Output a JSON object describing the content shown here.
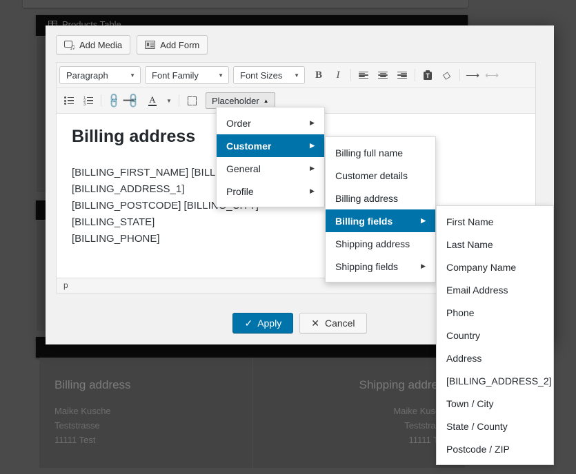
{
  "background": {
    "panel_title": "Products Table",
    "addresses": [
      {
        "title": "Billing address",
        "lines": [
          "Maike Kusche",
          "Teststrasse",
          "11111 Test"
        ]
      },
      {
        "title": "Shipping address",
        "lines": [
          "Maike Kusche",
          "Teststrasse",
          "11111 Test"
        ]
      }
    ]
  },
  "modal": {
    "media_button": "Add Media",
    "form_button": "Add Form",
    "toolbar": {
      "paragraph_select": "Paragraph",
      "font_family_select": "Font Family",
      "font_sizes_select": "Font Sizes",
      "bold": "B",
      "italic": "I",
      "placeholder_button": "Placeholder",
      "placeholder_caret": "▲"
    },
    "content": {
      "heading": "Billing address",
      "body": "[BILLING_FIRST_NAME] [BILLING_LAST_NAME]\n[BILLING_ADDRESS_1]\n[BILLING_POSTCODE] [BILLING_CITY]\n[BILLING_STATE]\n[BILLING_PHONE]"
    },
    "status_path": "p",
    "apply_button": "Apply",
    "cancel_button": "Cancel",
    "apply_icon": "✓",
    "cancel_icon": "✕"
  },
  "menus": {
    "level1": {
      "items": [
        {
          "label": "Order",
          "has_submenu": true,
          "selected": false
        },
        {
          "label": "Customer",
          "has_submenu": true,
          "selected": true
        },
        {
          "label": "General",
          "has_submenu": true,
          "selected": false
        },
        {
          "label": "Profile",
          "has_submenu": true,
          "selected": false
        }
      ]
    },
    "level2": {
      "items": [
        {
          "label": "Billing full name",
          "has_submenu": false,
          "selected": false
        },
        {
          "label": "Customer details",
          "has_submenu": false,
          "selected": false
        },
        {
          "label": "Billing address",
          "has_submenu": false,
          "selected": false
        },
        {
          "label": "Billing fields",
          "has_submenu": true,
          "selected": true
        },
        {
          "label": "Shipping address",
          "has_submenu": false,
          "selected": false
        },
        {
          "label": "Shipping fields",
          "has_submenu": true,
          "selected": false
        }
      ]
    },
    "level3": {
      "items": [
        {
          "label": "First Name",
          "has_submenu": false,
          "selected": false
        },
        {
          "label": "Last Name",
          "has_submenu": false,
          "selected": false
        },
        {
          "label": "Company Name",
          "has_submenu": false,
          "selected": false
        },
        {
          "label": "Email Address",
          "has_submenu": false,
          "selected": false
        },
        {
          "label": "Phone",
          "has_submenu": false,
          "selected": false
        },
        {
          "label": "Country",
          "has_submenu": false,
          "selected": false
        },
        {
          "label": "Address",
          "has_submenu": false,
          "selected": false
        },
        {
          "label": "[BILLING_ADDRESS_2]",
          "has_submenu": false,
          "selected": false
        },
        {
          "label": "Town / City",
          "has_submenu": false,
          "selected": false
        },
        {
          "label": "State / County",
          "has_submenu": false,
          "selected": false
        },
        {
          "label": "Postcode / ZIP",
          "has_submenu": false,
          "selected": false
        }
      ]
    }
  },
  "colors": {
    "accent": "#0073aa",
    "page_bg": "#4a4a4a",
    "modal_bg": "#f1f1f1"
  }
}
